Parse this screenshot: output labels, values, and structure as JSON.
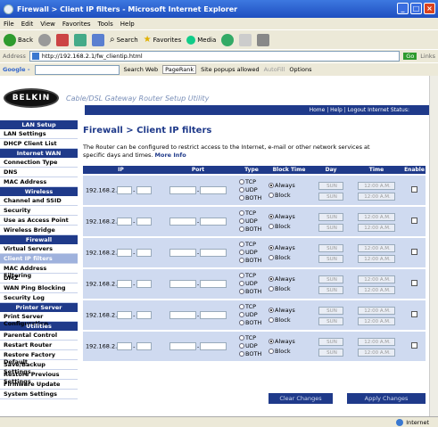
{
  "window": {
    "title": "Firewall > Client IP filters - Microsoft Internet Explorer"
  },
  "menu": [
    "File",
    "Edit",
    "View",
    "Favorites",
    "Tools",
    "Help"
  ],
  "toolbar": {
    "back": "Back",
    "search": "Search",
    "favorites": "Favorites",
    "media": "Media"
  },
  "address": {
    "label": "Address",
    "url": "http://192.168.2.1/fw_clientip.html",
    "go": "Go",
    "links": "Links"
  },
  "google": {
    "label": "Google -",
    "search_web": "Search Web",
    "pagerank": "PageRank",
    "popups": "Site popups allowed",
    "autofill": "AutoFill",
    "options": "Options"
  },
  "header": {
    "logo": "BELKIN",
    "utility": "Cable/DSL Gateway Router Setup Utility",
    "links": "Home | Help | Logout   Internet Status:"
  },
  "sidebar": [
    {
      "type": "h",
      "label": "LAN Setup"
    },
    {
      "type": "i",
      "label": "LAN Settings"
    },
    {
      "type": "i",
      "label": "DHCP Client List"
    },
    {
      "type": "h",
      "label": "Internet WAN"
    },
    {
      "type": "i",
      "label": "Connection Type"
    },
    {
      "type": "i",
      "label": "DNS"
    },
    {
      "type": "i",
      "label": "MAC Address"
    },
    {
      "type": "h",
      "label": "Wireless"
    },
    {
      "type": "i",
      "label": "Channel and SSID"
    },
    {
      "type": "i",
      "label": "Security"
    },
    {
      "type": "i",
      "label": "Use as Access Point"
    },
    {
      "type": "i",
      "label": "Wireless Bridge"
    },
    {
      "type": "h",
      "label": "Firewall"
    },
    {
      "type": "i",
      "label": "Virtual Servers"
    },
    {
      "type": "a",
      "label": "Client IP filters"
    },
    {
      "type": "i",
      "label": "MAC Address Filtering"
    },
    {
      "type": "i",
      "label": "DMZ"
    },
    {
      "type": "i",
      "label": "WAN Ping Blocking"
    },
    {
      "type": "i",
      "label": "Security Log"
    },
    {
      "type": "h",
      "label": "Printer Server"
    },
    {
      "type": "i",
      "label": "Print Server Configuration"
    },
    {
      "type": "h",
      "label": "Utilities"
    },
    {
      "type": "i",
      "label": "Parental Control"
    },
    {
      "type": "i",
      "label": "Restart Router"
    },
    {
      "type": "i",
      "label": "Restore Factory Default"
    },
    {
      "type": "i",
      "label": "Save/Backup Settings"
    },
    {
      "type": "i",
      "label": "Restore Previous Settings"
    },
    {
      "type": "i",
      "label": "Firmware Update"
    },
    {
      "type": "i",
      "label": "System Settings"
    }
  ],
  "main": {
    "title": "Firewall > Client IP filters",
    "description": "The Router can be configured to restrict access to the Internet, e-mail or other network services at specific days and times.",
    "more_info": "More Info"
  },
  "table": {
    "headers": [
      "IP",
      "Port",
      "Type",
      "Block Time",
      "Day",
      "Time",
      "Enable"
    ],
    "ip_prefix": "192.168.2.",
    "type_options": [
      "TCP",
      "UDP",
      "BOTH"
    ],
    "block_options": [
      "Always",
      "Block"
    ],
    "day_value": "SUN",
    "time_value": "12:00 A.M.",
    "row_count": 6
  },
  "buttons": {
    "clear": "Clear Changes",
    "apply": "Apply Changes"
  },
  "status": {
    "zone": "Internet"
  }
}
